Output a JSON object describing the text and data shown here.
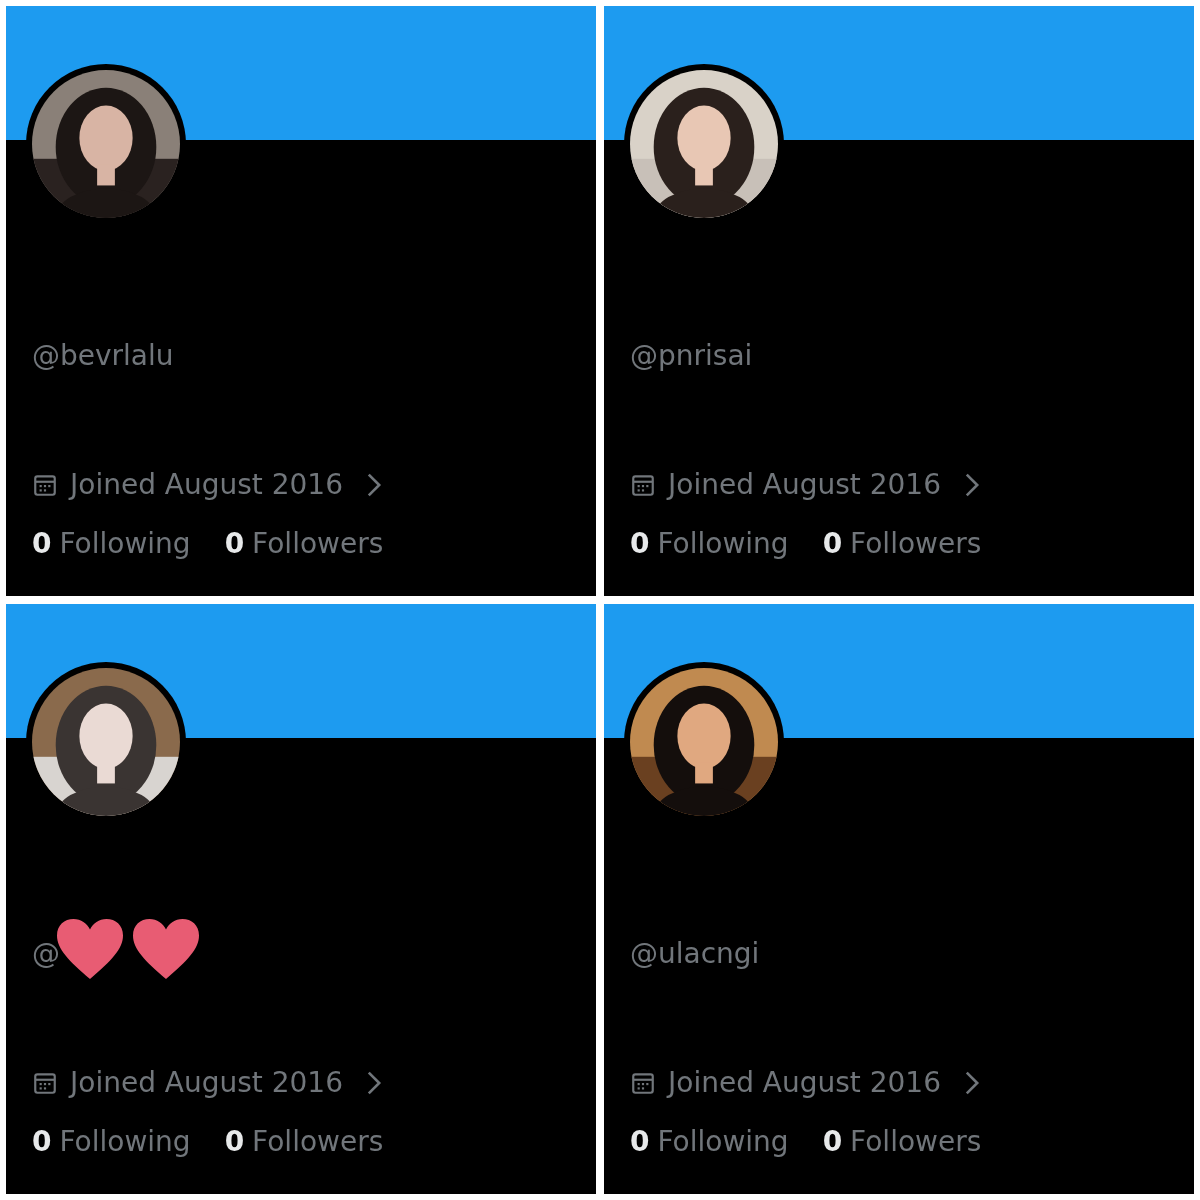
{
  "profiles": [
    {
      "handle": "@bevrlalu",
      "joined": "Joined August 2016",
      "following_count": "0",
      "following_label": "Following",
      "followers_count": "0",
      "followers_label": "Followers"
    },
    {
      "handle": "@pnrisai",
      "joined": "Joined August 2016",
      "following_count": "0",
      "following_label": "Following",
      "followers_count": "0",
      "followers_label": "Followers"
    },
    {
      "handle": "@",
      "joined": "Joined August 2016",
      "following_count": "0",
      "following_label": "Following",
      "followers_count": "0",
      "followers_label": "Followers",
      "stickers": [
        {
          "kind": "heart"
        },
        {
          "kind": "heart"
        }
      ]
    },
    {
      "handle": "@ulacngi",
      "joined": "Joined August 2016",
      "following_count": "0",
      "following_label": "Following",
      "followers_count": "0",
      "followers_label": "Followers"
    }
  ]
}
